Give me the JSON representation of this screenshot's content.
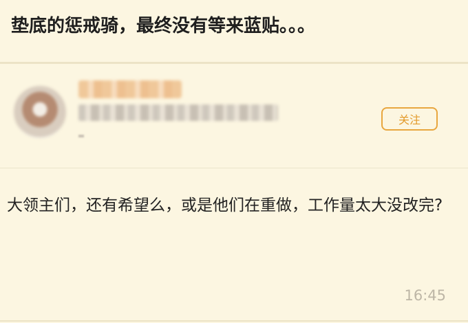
{
  "post": {
    "title": "垫底的惩戒骑，最终没有等来蓝贴。。。"
  },
  "author": {
    "avatar": "blurred-avatar",
    "follow_label": "关注"
  },
  "reply": {
    "text": "大领主们，还有希望么，或是他们在重做，工作量太大没改完?",
    "time": "16:45"
  },
  "colors": {
    "background": "#fcf6e1",
    "accent": "#e8a63e",
    "timestamp": "#bdb6a6"
  }
}
